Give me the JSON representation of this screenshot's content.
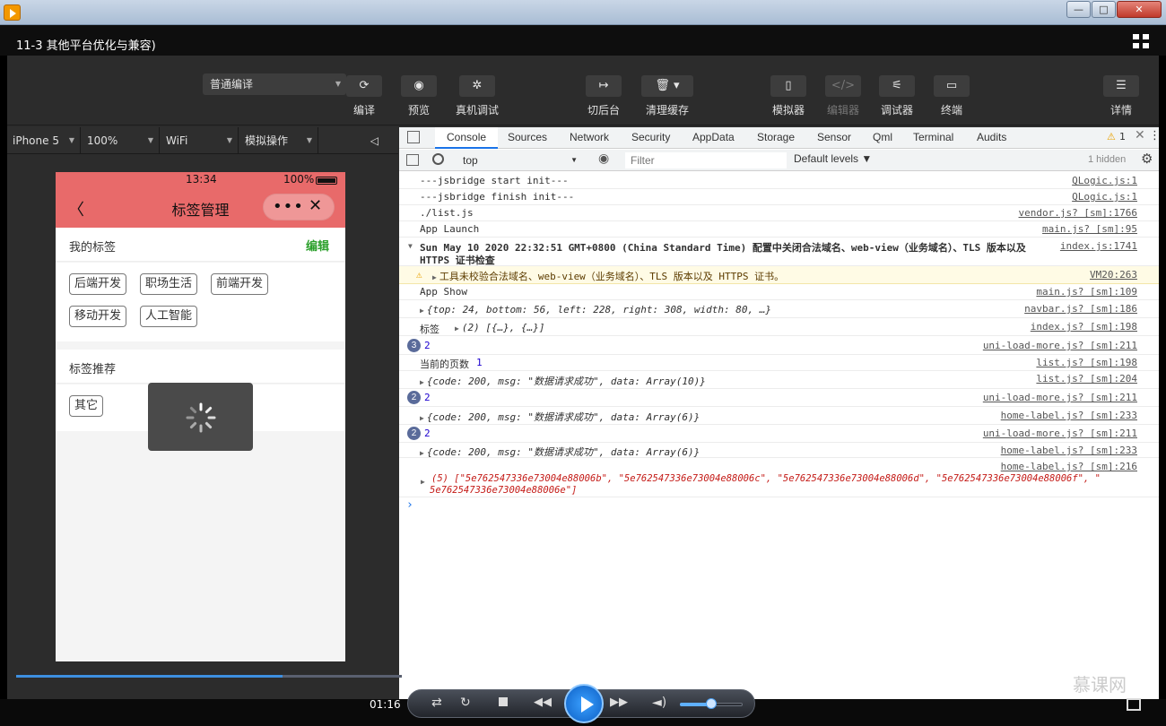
{
  "window": {
    "min": "—",
    "restore": "□",
    "close": "✕"
  },
  "player": {
    "title": "11-3 其他平台优化与兼容)",
    "time": "01:16",
    "progress": 0.69,
    "volume": 0.5
  },
  "toolbar": {
    "compile_mode": "普通编译",
    "buttons": {
      "compile": "编译",
      "preview": "预览",
      "debug": "真机调试",
      "background": "切后台",
      "clear_cache": "清理缓存",
      "simulator": "模拟器",
      "editor": "编辑器",
      "debugger": "调试器",
      "terminal": "终端",
      "details": "详情"
    }
  },
  "sim_bar": {
    "device": "iPhone 5",
    "zoom": "100%",
    "network": "WiFi",
    "operation": "模拟操作"
  },
  "phone": {
    "time": "13:34",
    "battery": "100%",
    "page_title": "标签管理",
    "my_tags_label": "我的标签",
    "edit_label": "编辑",
    "my_tags": [
      "后端开发",
      "职场生活",
      "前端开发",
      "移动开发",
      "人工智能"
    ],
    "recommend_label": "标签推荐",
    "recommend_tags": [
      "其它"
    ]
  },
  "devtools": {
    "tabs": [
      "Console",
      "Sources",
      "Network",
      "Security",
      "AppData",
      "Storage",
      "Sensor",
      "Qml",
      "Terminal",
      "Audits"
    ],
    "warn_count": "1",
    "context": "top",
    "filter_placeholder": "Filter",
    "levels": "Default levels ▼",
    "hidden": "1 hidden",
    "rows": [
      {
        "msg": "---jsbridge start init---",
        "src": "QLogic.js:1"
      },
      {
        "msg": "---jsbridge finish init---",
        "src": "QLogic.js:1"
      },
      {
        "msg": "./list.js",
        "src": "vendor.js? [sm]:1766"
      },
      {
        "msg": "App Launch",
        "src": "main.js? [sm]:95"
      },
      {
        "msg1": "Sun May 10 2020 22:32:51 GMT+0800 (China Standard Time) 配置中关闭合法域名、web-view（业务域名）、TLS 版本以及",
        "msg2": "HTTPS 证书检查",
        "src": "index.js:1741"
      },
      {
        "msg": "工具未校验合法域名、web-view（业务域名）、TLS 版本以及 HTTPS 证书。",
        "src": "VM20:263"
      },
      {
        "msg": "App Show",
        "src": "main.js? [sm]:109"
      },
      {
        "msg": "{top: 24, bottom: 56, left: 228, right: 308, width: 80, …}",
        "src": "navbar.js? [sm]:186"
      },
      {
        "label": "标签",
        "msg": "(2) [{…}, {…}]",
        "src": "index.js? [sm]:198"
      },
      {
        "badge": "3",
        "msg": "2",
        "src": "uni-load-more.js? [sm]:211"
      },
      {
        "label": "当前的页数",
        "msg": "1",
        "src": "list.js? [sm]:198"
      },
      {
        "msg": "{code: 200, msg: \"数据请求成功\", data: Array(10)}",
        "src": "list.js? [sm]:204"
      },
      {
        "badge": "2",
        "msg": "2",
        "src": "uni-load-more.js? [sm]:211"
      },
      {
        "msg": "{code: 200, msg: \"数据请求成功\", data: Array(6)}",
        "src": "home-label.js? [sm]:233"
      },
      {
        "badge": "2",
        "msg": "2",
        "src": "uni-load-more.js? [sm]:211"
      },
      {
        "msg": "{code: 200, msg: \"数据请求成功\", data: Array(6)}",
        "src": "home-label.js? [sm]:233"
      },
      {
        "msg1": "(5) [\"5e762547336e73004e88006b\", \"5e762547336e73004e88006c\", \"5e762547336e73004e88006d\", \"5e762547336e73004e88006f\", \"",
        "msg2": "5e762547336e73004e88006e\"]",
        "src": "home-label.js? [sm]:216"
      }
    ],
    "prompt": "›"
  },
  "watermark": "慕课网"
}
